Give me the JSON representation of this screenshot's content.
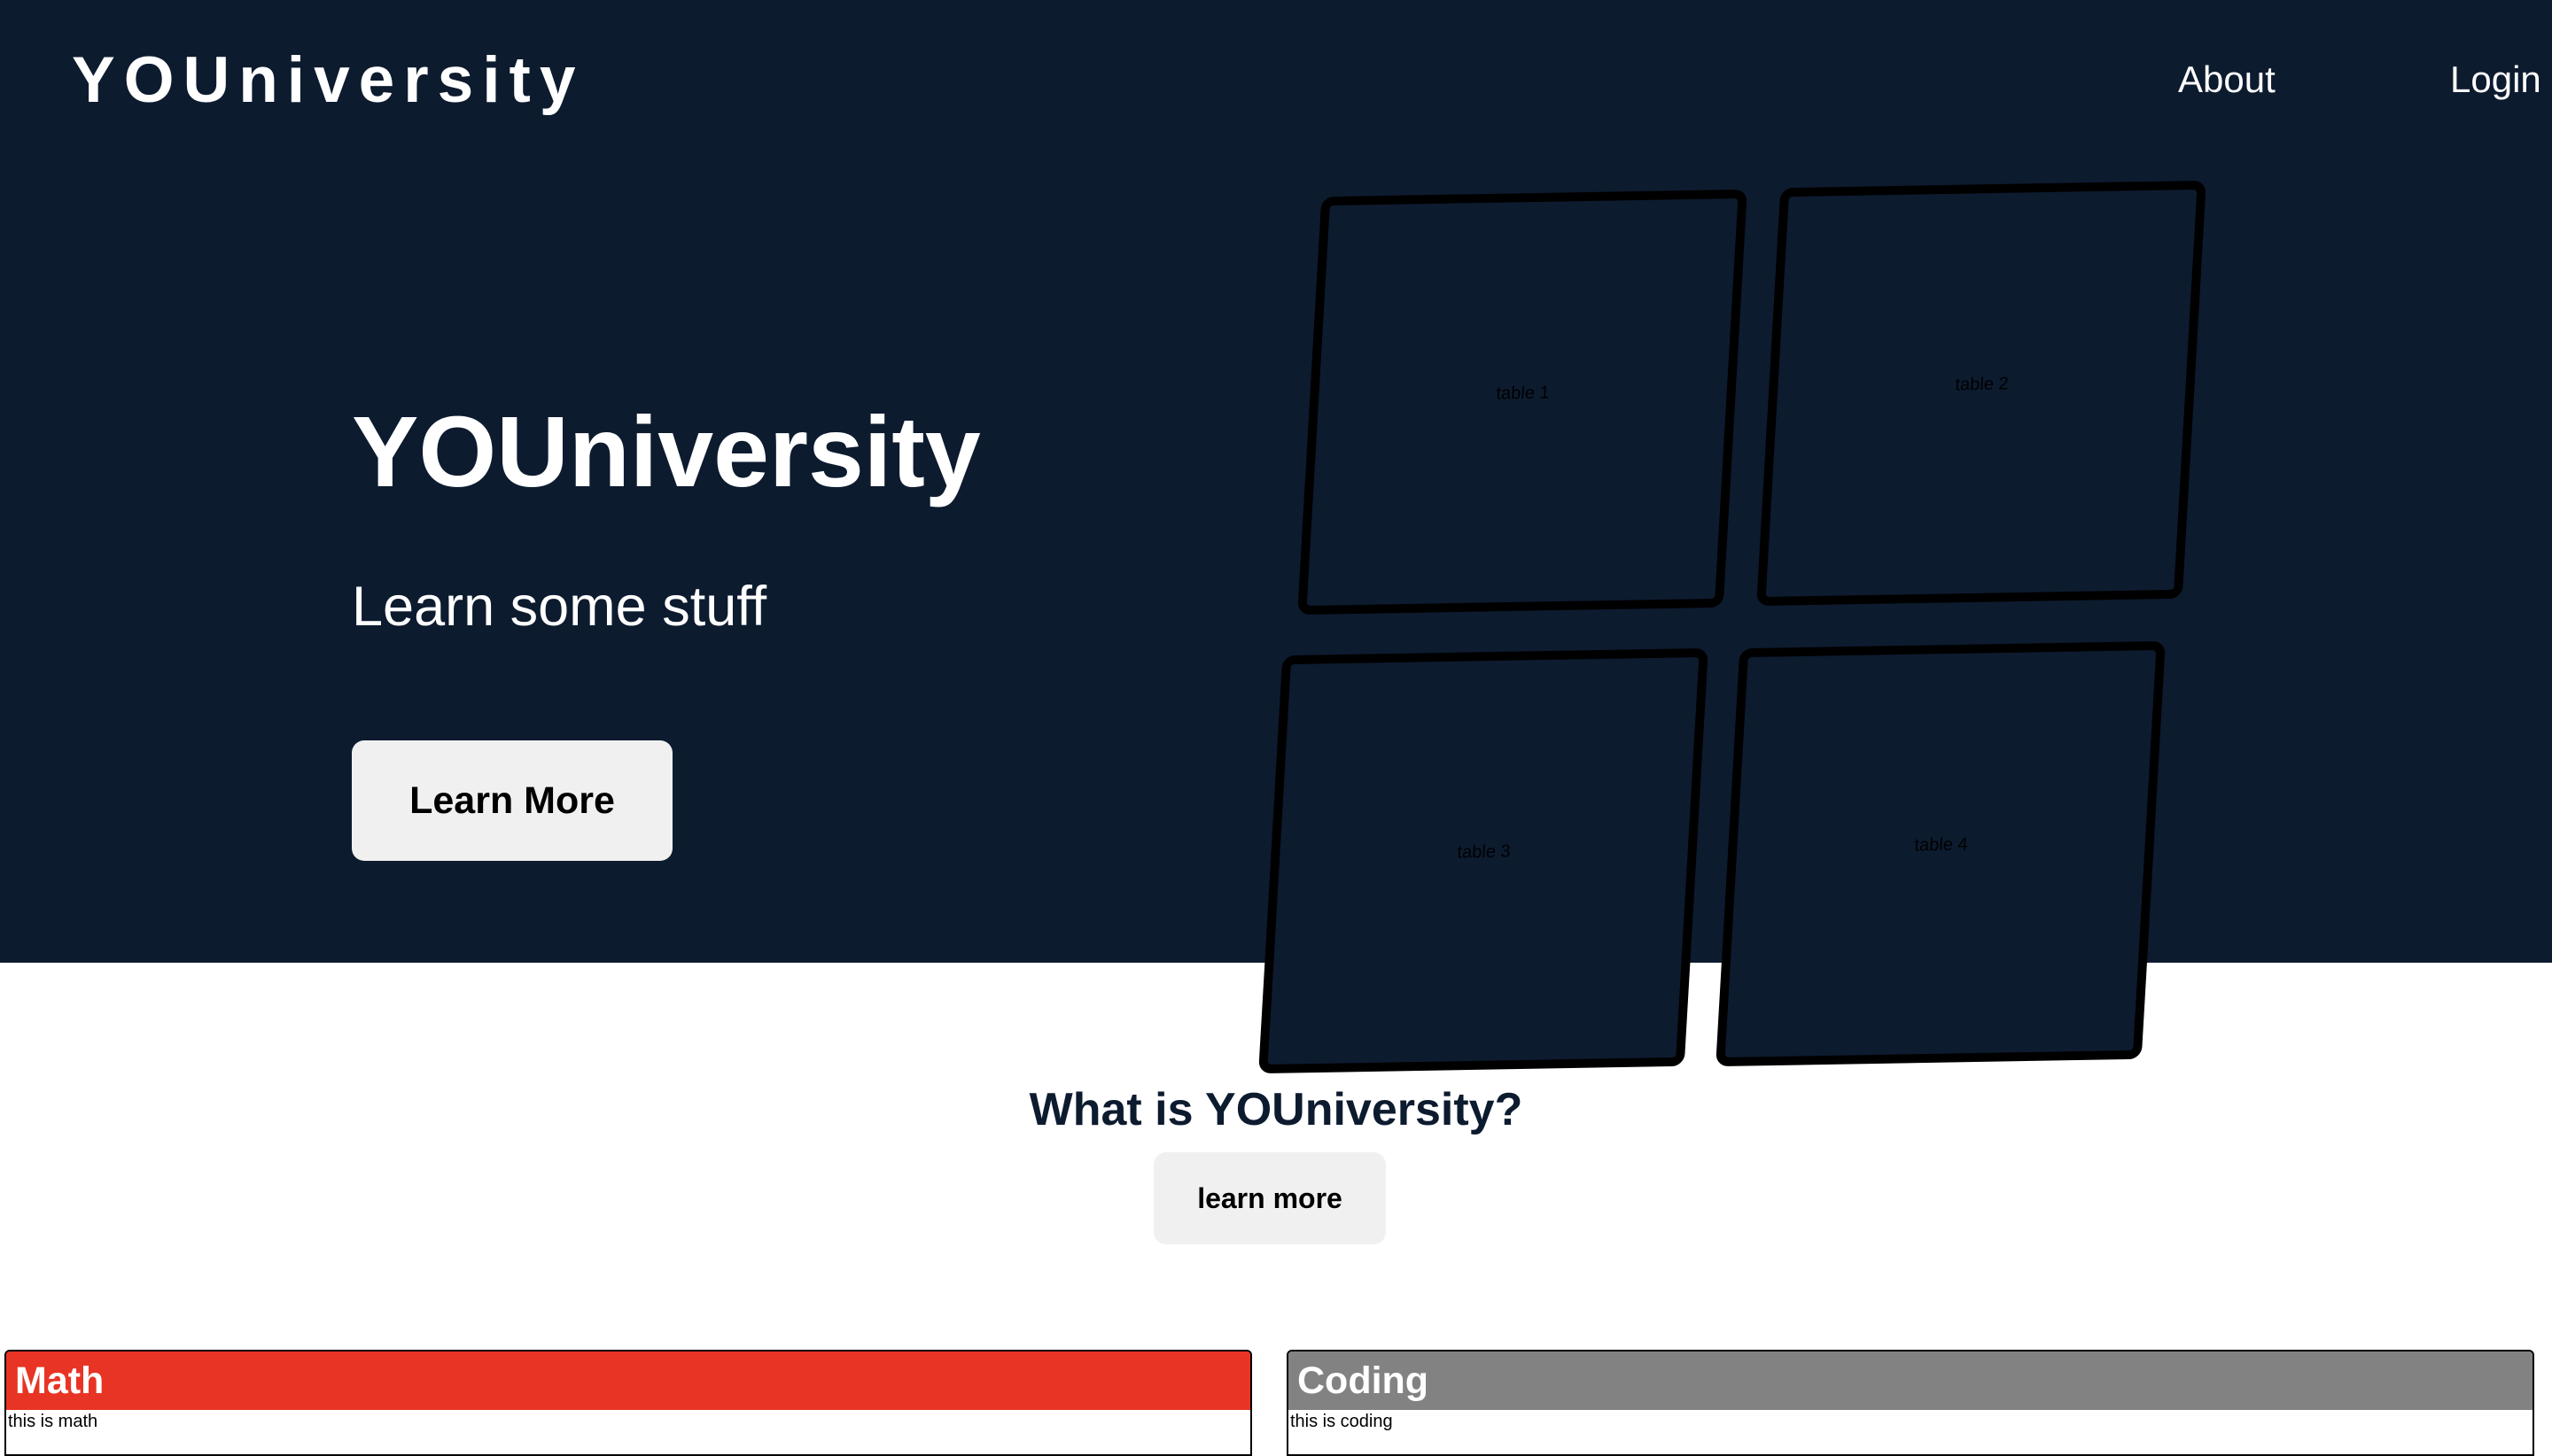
{
  "nav": {
    "logo": "YOUniversity",
    "links": [
      {
        "label": "About"
      },
      {
        "label": "Login"
      }
    ]
  },
  "hero": {
    "title": "YOUniversity",
    "subtitle": "Learn some stuff",
    "button_label": "Learn More",
    "background_color": "#0d1b2f"
  },
  "tables": [
    {
      "label": "table 1"
    },
    {
      "label": "table 2"
    },
    {
      "label": "table 3"
    },
    {
      "label": "table 4"
    }
  ],
  "about": {
    "heading": "What is YOUniversity?",
    "button_label": "learn more"
  },
  "subjects": [
    {
      "title": "Math",
      "description": "this is math",
      "color": "#e83424"
    },
    {
      "title": "Coding",
      "description": "this is coding",
      "color": "#828282"
    }
  ]
}
